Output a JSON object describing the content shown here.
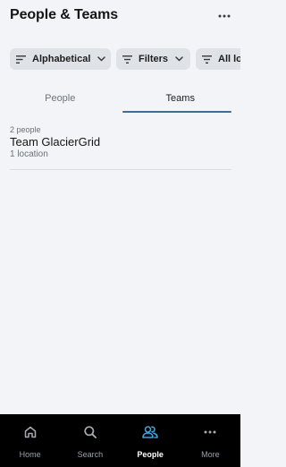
{
  "header": {
    "title": "People & Teams",
    "more_icon": "more-horizontal-icon"
  },
  "chips": {
    "sort_label": "Alphabetical",
    "filters_label": "Filters",
    "location_label": "All lo"
  },
  "tabs": [
    {
      "label": "People",
      "active": false
    },
    {
      "label": "Teams",
      "active": true
    }
  ],
  "teams": [
    {
      "count": "2 people",
      "name": "Team GlacierGrid",
      "locations": "1 location"
    }
  ],
  "nav": {
    "items": [
      {
        "label": "Home",
        "icon": "home-icon",
        "active": false
      },
      {
        "label": "Search",
        "icon": "search-icon",
        "active": false
      },
      {
        "label": "People",
        "icon": "people-icon",
        "active": true
      },
      {
        "label": "More",
        "icon": "more-horizontal-icon",
        "active": false
      }
    ]
  },
  "colors": {
    "accent": "#3b6e94",
    "active_nav_icon": "#3ba3d9",
    "background": "#f2f4f7",
    "chip_bg": "#dfe2e7",
    "nav_bg": "#000000"
  }
}
